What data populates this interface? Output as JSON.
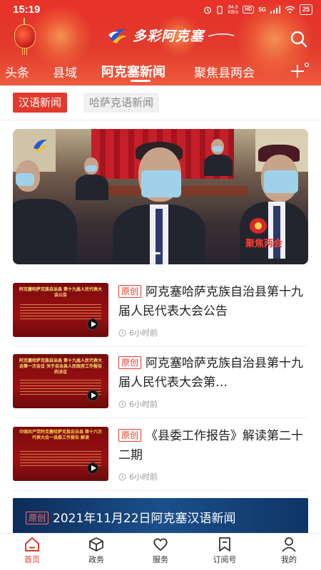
{
  "status_bar": {
    "time": "15:19",
    "net_speed_value": "84.9",
    "net_speed_unit": "KB/s",
    "hd_label": "HD",
    "signal_label": "5G",
    "battery": "25"
  },
  "header": {
    "app_name": "多彩阿克塞",
    "search_icon": "search-icon"
  },
  "tabs": {
    "items": [
      {
        "label": "头条"
      },
      {
        "label": "县域"
      },
      {
        "label": "阿克塞新闻"
      },
      {
        "label": "聚焦县两会"
      }
    ],
    "active_index": 2,
    "add_icon": "plus-icon"
  },
  "subtabs": {
    "items": [
      {
        "label": "汉语新闻"
      },
      {
        "label": "哈萨克语新闻"
      }
    ],
    "active_index": 0
  },
  "banner": {
    "badge": "聚焦两会",
    "slide_count": 2,
    "active_slide": 0
  },
  "news": [
    {
      "tag": "原创",
      "title": "阿克塞哈萨克族自治县第十九届人民代表大会公告",
      "time": "6小时前",
      "thumb_title": "阿克塞哈萨克族自治县 第十九届人民代表大会公告"
    },
    {
      "tag": "原创",
      "title": "阿克塞哈萨克族自治县第十九届人民代表大会第…",
      "time": "6小时前",
      "thumb_title": "阿克塞哈萨克族自治县 第十九届人民代表大会第一次会议 关于自治县人民政府工作报告的决议"
    },
    {
      "tag": "原创",
      "title": "《县委工作报告》解读第二十二期",
      "time": "6小时前",
      "thumb_title": "中国共产党阿克塞哈萨克族自治县 第十六次代表大会一县委工作报告 解读"
    }
  ],
  "video_card": {
    "tag": "原创",
    "title": "2021年11月22日阿克塞汉语新闻"
  },
  "bottom_nav": {
    "items": [
      {
        "label": "首页",
        "icon": "home-icon"
      },
      {
        "label": "政务",
        "icon": "cube-icon"
      },
      {
        "label": "服务",
        "icon": "heart-icon"
      },
      {
        "label": "订阅号",
        "icon": "bookmark-icon"
      },
      {
        "label": "我的",
        "icon": "user-icon"
      }
    ],
    "active_index": 0
  },
  "colors": {
    "brand_red": "#e23a2c",
    "white": "#ffffff",
    "meta_gray": "#999999"
  }
}
